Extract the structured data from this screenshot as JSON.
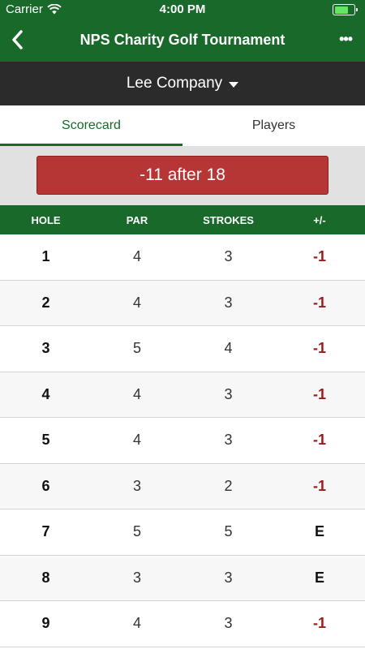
{
  "status_bar": {
    "carrier": "Carrier",
    "time": "4:00 PM",
    "wifi_icon": "wifi-icon",
    "battery_icon": "battery-charging-icon"
  },
  "nav": {
    "title": "NPS Charity Golf Tournament",
    "back_icon": "chevron-left-icon",
    "more_icon": "ellipsis-icon",
    "more_label": "•••"
  },
  "team": {
    "name": "Lee Company",
    "dropdown_icon": "caret-down-icon"
  },
  "tabs": [
    {
      "label": "Scorecard",
      "active": true
    },
    {
      "label": "Players",
      "active": false
    }
  ],
  "score_summary": "-11 after 18",
  "table": {
    "headers": {
      "hole": "HOLE",
      "par": "PAR",
      "strokes": "STROKES",
      "diff": "+/-"
    },
    "rows": [
      {
        "hole": "1",
        "par": "4",
        "strokes": "3",
        "diff": "-1"
      },
      {
        "hole": "2",
        "par": "4",
        "strokes": "3",
        "diff": "-1"
      },
      {
        "hole": "3",
        "par": "5",
        "strokes": "4",
        "diff": "-1"
      },
      {
        "hole": "4",
        "par": "4",
        "strokes": "3",
        "diff": "-1"
      },
      {
        "hole": "5",
        "par": "4",
        "strokes": "3",
        "diff": "-1"
      },
      {
        "hole": "6",
        "par": "3",
        "strokes": "2",
        "diff": "-1"
      },
      {
        "hole": "7",
        "par": "5",
        "strokes": "5",
        "diff": "E"
      },
      {
        "hole": "8",
        "par": "3",
        "strokes": "3",
        "diff": "E"
      },
      {
        "hole": "9",
        "par": "4",
        "strokes": "3",
        "diff": "-1"
      }
    ]
  },
  "colors": {
    "brand_green": "#18692a",
    "score_red": "#b63636",
    "under_par_text": "#9b1b1b",
    "team_bar": "#2b2b2b"
  }
}
